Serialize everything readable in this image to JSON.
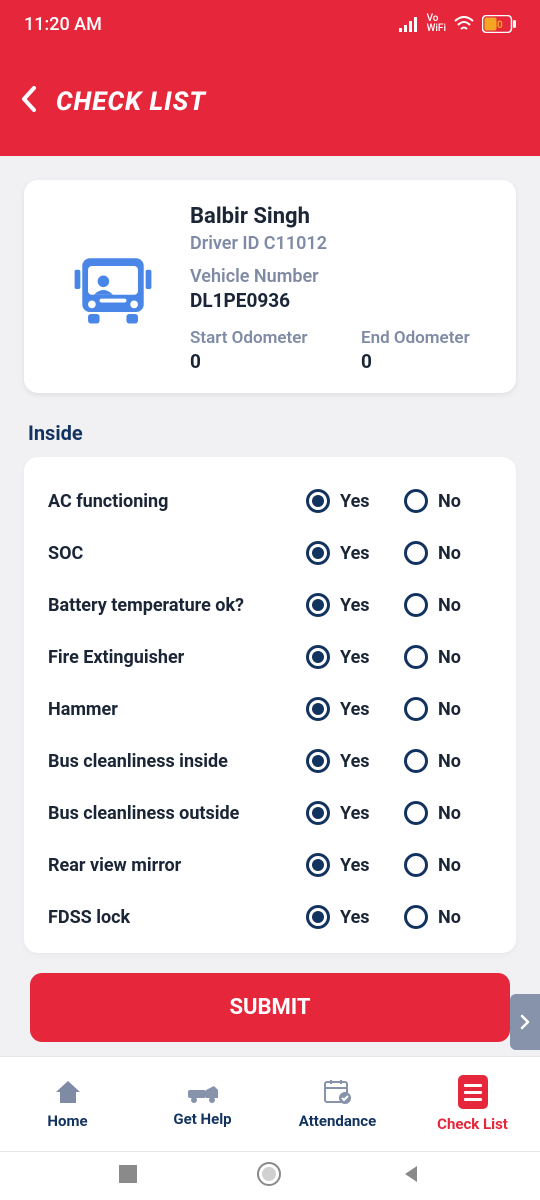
{
  "status": {
    "time": "11:20 AM",
    "battery": "40"
  },
  "header": {
    "title": "CHECK LIST"
  },
  "driver": {
    "name": "Balbir Singh",
    "id_label": "Driver ID C11012",
    "vehicle_label": "Vehicle Number",
    "vehicle_number": "DL1PE0936",
    "start_odo_label": "Start Odometer",
    "start_odo": "0",
    "end_odo_label": "End Odometer",
    "end_odo": "0"
  },
  "section_inside": "Inside",
  "options": {
    "yes": "Yes",
    "no": "No"
  },
  "items": [
    {
      "label": "AC functioning",
      "selected": "yes"
    },
    {
      "label": "SOC",
      "selected": "yes"
    },
    {
      "label": "Battery temperature ok?",
      "selected": "yes"
    },
    {
      "label": "Fire Extinguisher",
      "selected": "yes"
    },
    {
      "label": "Hammer",
      "selected": "yes"
    },
    {
      "label": "Bus cleanliness inside",
      "selected": "yes"
    },
    {
      "label": "Bus cleanliness outside",
      "selected": "yes"
    },
    {
      "label": "Rear view mirror",
      "selected": "yes"
    },
    {
      "label": "FDSS lock",
      "selected": "yes"
    }
  ],
  "submit_label": "SUBMIT",
  "tabs": {
    "home": "Home",
    "help": "Get Help",
    "attendance": "Attendance",
    "checklist": "Check List"
  }
}
